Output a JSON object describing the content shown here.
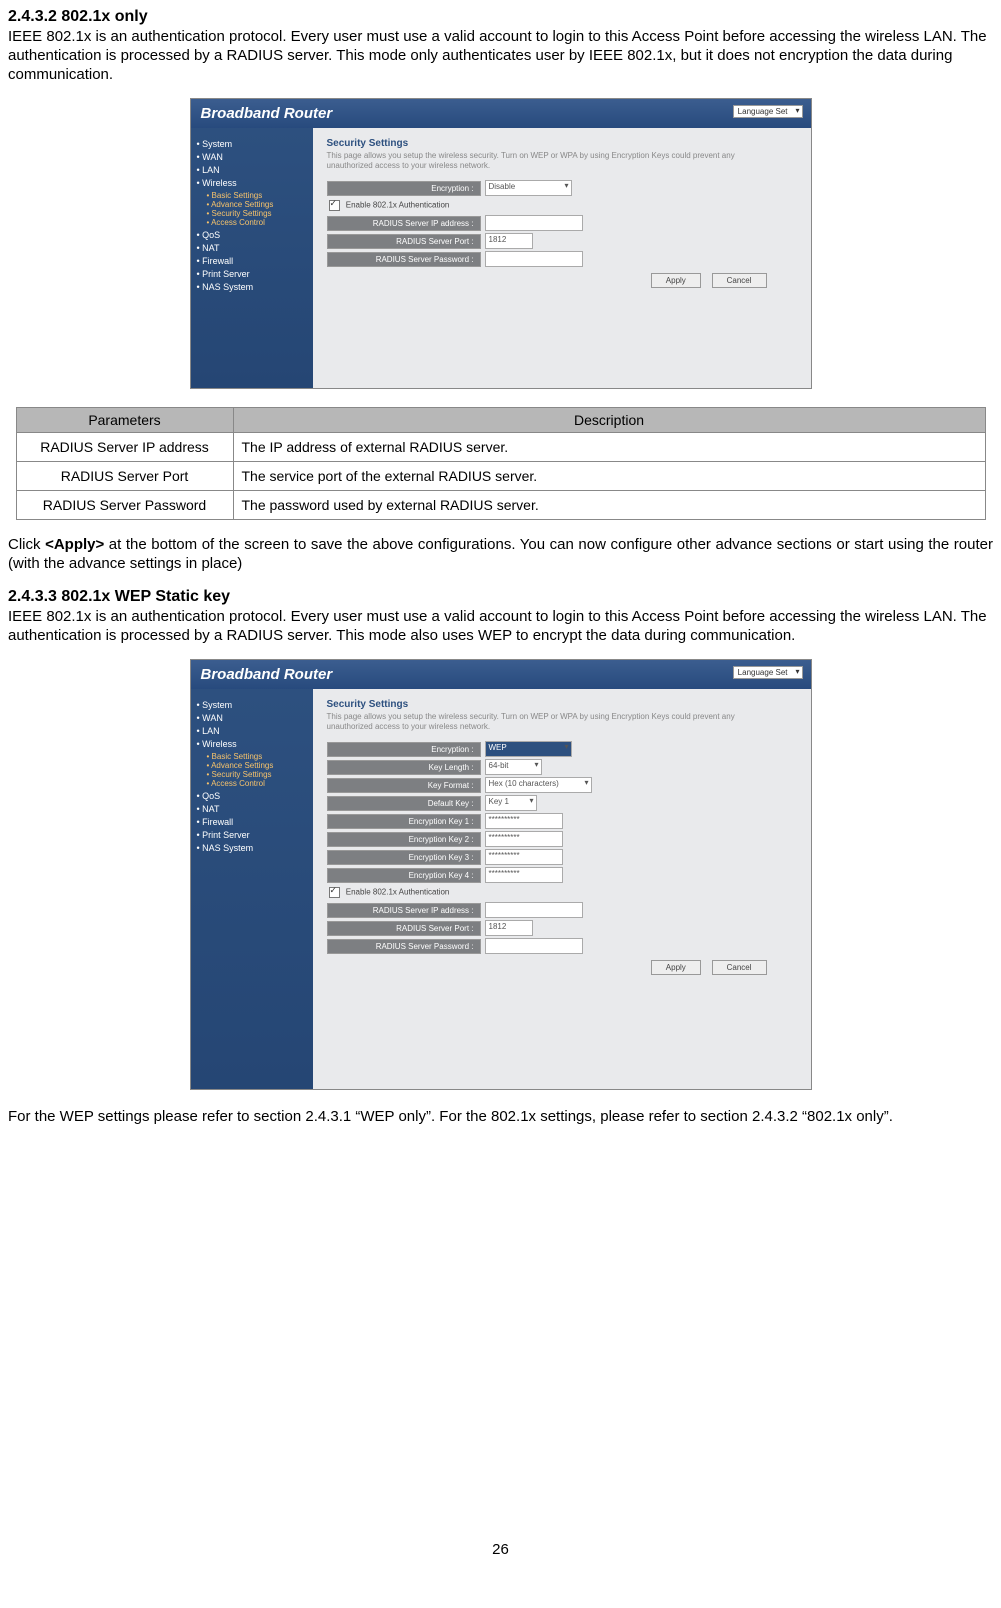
{
  "section1": {
    "heading": "2.4.3.2 802.1x only",
    "para": "IEEE 802.1x is an authentication protocol. Every user must use a valid account to login to this Access Point before accessing the wireless LAN. The authentication is processed by a RADIUS server. This mode only authenticates user by IEEE 802.1x, but it does not encryption the data during communication."
  },
  "router_common": {
    "brand": "Broadband Router",
    "lang": "Language Set",
    "panel_title": "Security Settings",
    "nav": [
      "System",
      "WAN",
      "LAN",
      "Wireless"
    ],
    "subnav": [
      "Basic Settings",
      "Advance Settings",
      "Security Settings",
      "Access Control"
    ],
    "nav2": [
      "QoS",
      "NAT",
      "Firewall",
      "Print Server",
      "NAS System"
    ],
    "apply": "Apply",
    "cancel": "Cancel"
  },
  "router1": {
    "desc": "This page allows you setup the wireless security. Turn on WEP or WPA by using Encryption Keys could prevent any unauthorized access to your wireless network.",
    "enc_label": "Encryption :",
    "enc_value": "Disable",
    "chk_label": "Enable 802.1x Authentication",
    "ip_label": "RADIUS Server IP address :",
    "port_label": "RADIUS Server Port :",
    "port_value": "1812",
    "pw_label": "RADIUS Server Password :"
  },
  "param_table": {
    "h1": "Parameters",
    "h2": "Description",
    "rows": [
      {
        "p": "RADIUS Server IP address",
        "d": "The IP address of external RADIUS server."
      },
      {
        "p": "RADIUS Server Port",
        "d": "The service port of the external RADIUS server."
      },
      {
        "p": "RADIUS Server Password",
        "d": "The password used by external RADIUS server."
      }
    ]
  },
  "apply_para": {
    "pre": "Click ",
    "bold": "<Apply>",
    "post": " at the bottom of the screen to save the above configurations. You can now configure other advance sections or start using the router (with the advance settings in place)"
  },
  "section2": {
    "heading": "2.4.3.3 802.1x WEP Static key",
    "para": "IEEE 802.1x is an authentication protocol. Every user must use a valid account to login to this Access Point before accessing the wireless LAN. The authentication is processed by a RADIUS server. This mode also uses WEP to encrypt the data during communication."
  },
  "router2": {
    "desc": "This page allows you setup the wireless security. Turn on WEP or WPA by using Encryption Keys could prevent any unauthorized access to your wireless network.",
    "enc_label": "Encryption :",
    "enc_value": "WEP",
    "keylen_label": "Key Length :",
    "keylen_value": "64-bit",
    "keyfmt_label": "Key Format :",
    "keyfmt_value": "Hex (10 characters)",
    "defkey_label": "Default Key :",
    "defkey_value": "Key 1",
    "k1_label": "Encryption Key 1 :",
    "k2_label": "Encryption Key 2 :",
    "k3_label": "Encryption Key 3 :",
    "k4_label": "Encryption Key 4 :",
    "key_mask": "**********",
    "chk_label": "Enable 802.1x Authentication",
    "ip_label": "RADIUS Server IP address :",
    "port_label": "RADIUS Server Port :",
    "port_value": "1812",
    "pw_label": "RADIUS Server Password :"
  },
  "footer_para": "For the WEP settings please refer to section 2.4.3.1 “WEP only”. For the 802.1x settings, please refer to section 2.4.3.2 “802.1x only”.",
  "page_number": "26"
}
